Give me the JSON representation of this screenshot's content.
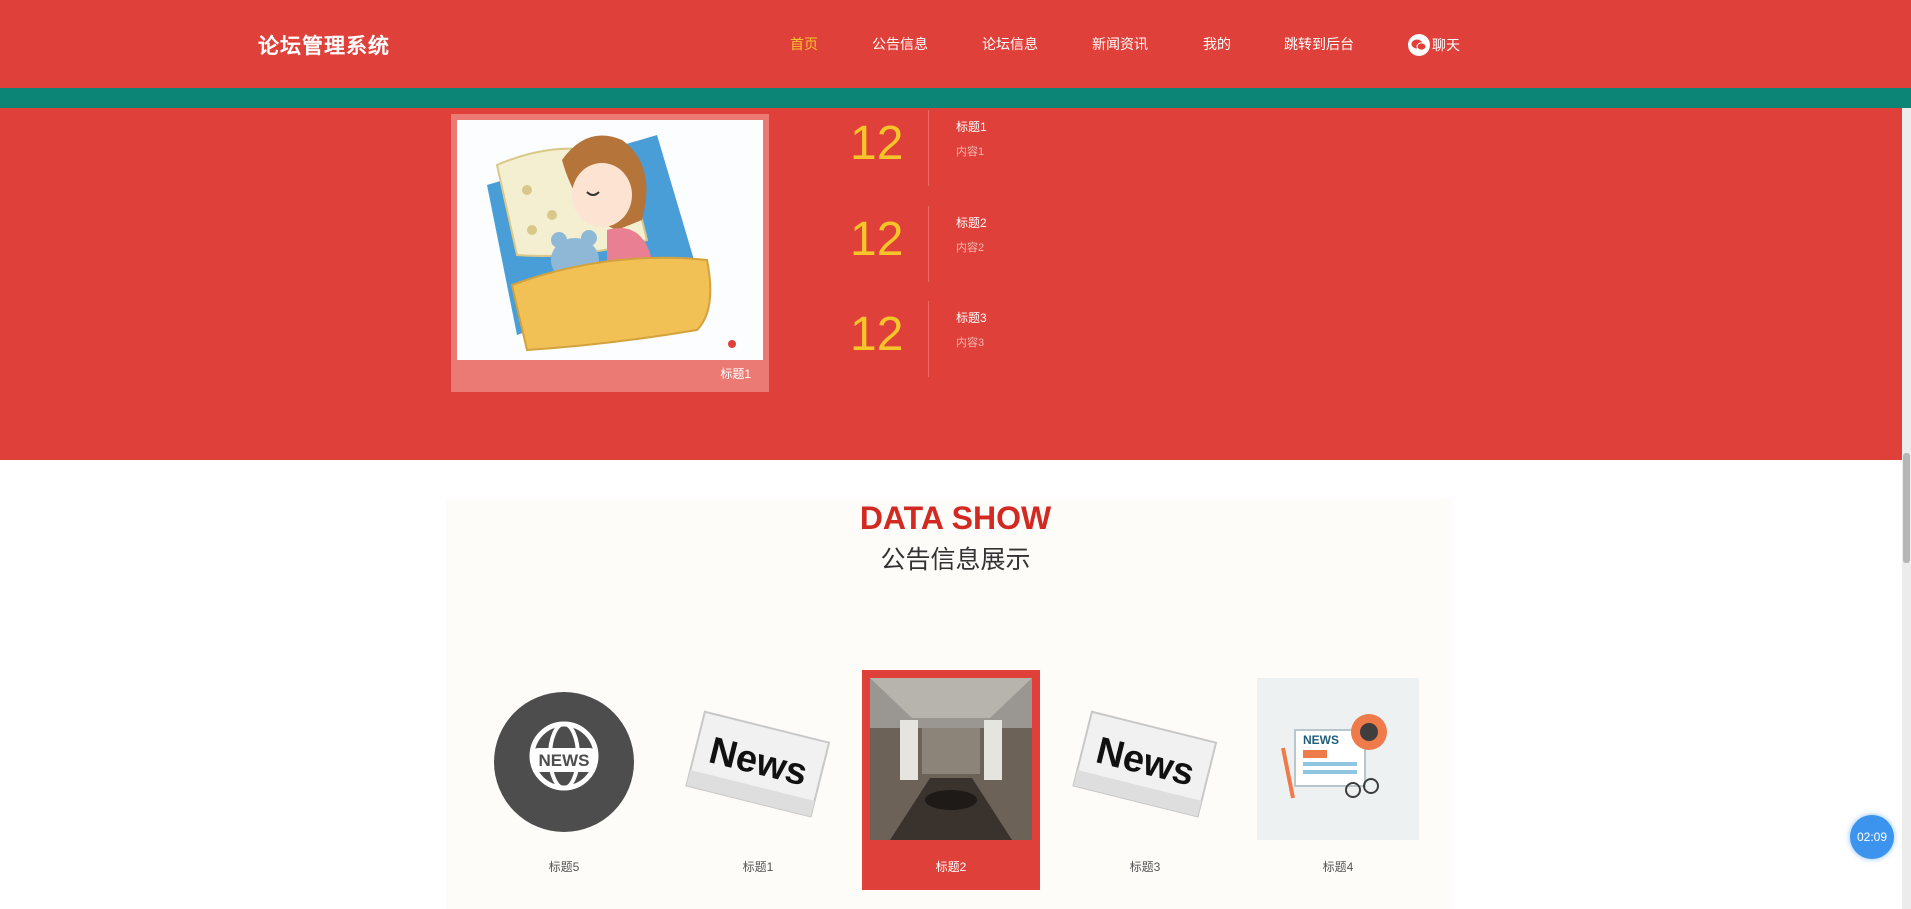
{
  "header": {
    "site_title": "论坛管理系统",
    "nav": [
      "首页",
      "公告信息",
      "论坛信息",
      "新闻资讯",
      "我的",
      "跳转到后台"
    ],
    "chat_label": "聊天",
    "chat_icon": "chat-bubble-icon",
    "active_color": "#f6c42d"
  },
  "hero": {
    "image_caption": "标题1",
    "items": [
      {
        "number": "12",
        "title": "标题1",
        "content": "内容1"
      },
      {
        "number": "12",
        "title": "标题2",
        "content": "内容2"
      },
      {
        "number": "12",
        "title": "标题3",
        "content": "内容3"
      }
    ]
  },
  "section": {
    "title": "DATA SHOW",
    "subtitle": "公告信息展示",
    "cards": [
      {
        "label": "标题5",
        "image": "news-globe-icon"
      },
      {
        "label": "标题1",
        "image": "newspaper-icon"
      },
      {
        "label": "标题2",
        "image": "meeting-room-photo",
        "active": true
      },
      {
        "label": "标题3",
        "image": "newspaper-icon"
      },
      {
        "label": "标题4",
        "image": "news-desk-icon"
      }
    ]
  },
  "timer": "02:09",
  "colors": {
    "brand_red": "#e0403a",
    "stripe": "#0d8576",
    "number_yellow": "#f5c52a",
    "title_red": "#d12a22"
  }
}
